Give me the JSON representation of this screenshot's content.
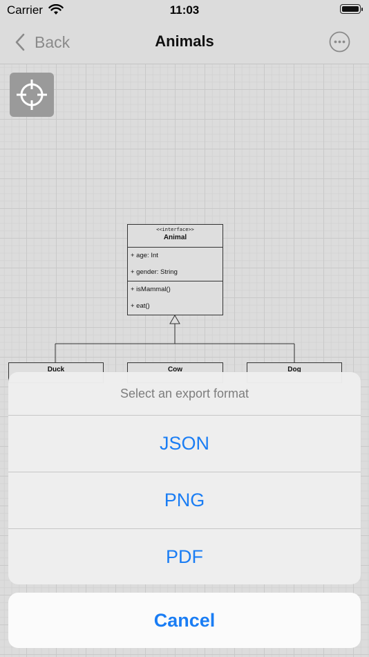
{
  "status_bar": {
    "carrier": "Carrier",
    "time": "11:03"
  },
  "nav": {
    "back_label": "Back",
    "title": "Animals"
  },
  "diagram": {
    "interface": {
      "stereotype": "<<interface>>",
      "name": "Animal",
      "attributes": [
        "+ age: Int",
        "+ gender: String"
      ],
      "methods": [
        "+ isMammal()",
        "+ eat()"
      ]
    },
    "subclasses": [
      "Duck",
      "Cow",
      "Dog"
    ]
  },
  "action_sheet": {
    "title": "Select an export format",
    "options": [
      "JSON",
      "PNG",
      "PDF"
    ],
    "cancel_label": "Cancel"
  },
  "colors": {
    "accent": "#1a7df4",
    "secondary_text": "#7d7d7d"
  }
}
